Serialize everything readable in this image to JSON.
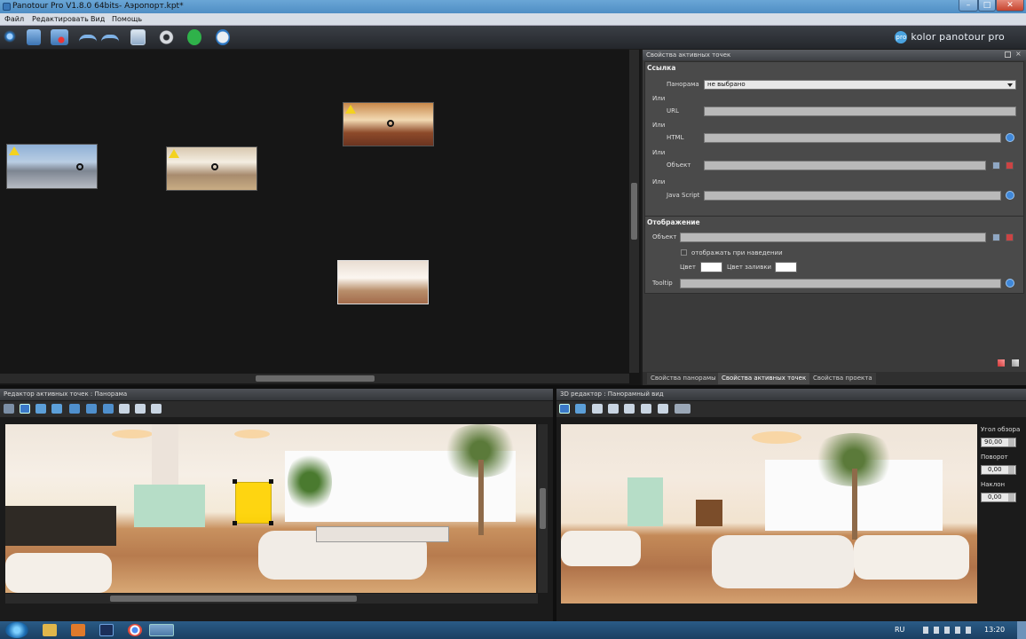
{
  "window": {
    "title": "Panotour Pro V1.8.0 64bits- Аэропорт.kpt*",
    "controls": [
      "–",
      "□",
      "✕"
    ]
  },
  "menu": [
    "Файл",
    "Редактировать",
    "Вид",
    "Помощь"
  ],
  "brand": "kolor panotour pro",
  "brand_logo": "pro",
  "hotspot_props": {
    "header": "Свойства активных точек",
    "link_section": "Ссылка",
    "panorama_label": "Панорама",
    "panorama_value": "не выбрано",
    "or1": "Или",
    "url_label": "URL",
    "or2": "Или",
    "html_label": "HTML",
    "or3": "Или",
    "object_label": "Объект",
    "or4": "Или",
    "js_label": "Java Script",
    "display_section": "Отображение",
    "display_object_label": "Объект",
    "show_on_hover": "отображать при наведении",
    "color_label": "Цвет",
    "fill_label": "Цвет заливки",
    "tooltip_label": "Tooltip"
  },
  "props_tabs": [
    "Свойства панорамы",
    "Свойства активных точек",
    "Свойства проекта"
  ],
  "hotspot_editor": {
    "header": "Редактор активных точек : Панорама"
  },
  "editor_3d": {
    "header": "3D редактор : Панорамный вид",
    "fov_label": "Угол обзора",
    "fov_value": "90,00",
    "rotation_label": "Поворот",
    "rotation_value": "0,00",
    "tilt_label": "Наклон",
    "tilt_value": "0,00"
  },
  "taskbar": {
    "lang": "RU",
    "time": "13:20"
  },
  "colors": {
    "accent_blue": "#3f87d8",
    "warning_yellow": "#f3d21f",
    "hotspot_yellow": "#ffd400"
  }
}
